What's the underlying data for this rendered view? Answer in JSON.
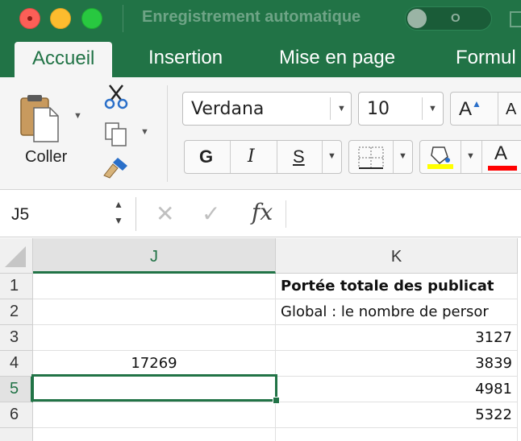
{
  "titlebar": {
    "autosave_label": "Enregistrement automatique",
    "toggle_state": "O"
  },
  "tabs": [
    {
      "label": "Accueil",
      "active": true
    },
    {
      "label": "Insertion",
      "active": false
    },
    {
      "label": "Mise en page",
      "active": false
    },
    {
      "label": "Formul",
      "active": false
    }
  ],
  "ribbon": {
    "paste_label": "Coller",
    "font_name": "Verdana",
    "font_size": "10",
    "grow_font_label": "A",
    "shrink_font_label": "A",
    "bold_label": "G",
    "italic_label": "I",
    "underline_label": "S",
    "font_color_label": "A",
    "fill_color": "#ffff00",
    "font_color": "#ff0000"
  },
  "formula_bar": {
    "name_box": "J5",
    "cancel_symbol": "✕",
    "enter_symbol": "✓",
    "fx_label": "fx",
    "formula_value": ""
  },
  "grid": {
    "columns": [
      {
        "label": "J",
        "selected": true
      },
      {
        "label": "K",
        "selected": false
      }
    ],
    "rows": [
      {
        "label": "1",
        "selected": false,
        "cells": [
          "",
          "Portée totale des publicat"
        ]
      },
      {
        "label": "2",
        "selected": false,
        "cells": [
          "",
          "Global : le nombre de persor"
        ]
      },
      {
        "label": "3",
        "selected": false,
        "cells": [
          "",
          "3127"
        ]
      },
      {
        "label": "4",
        "selected": false,
        "cells": [
          "17269",
          "3839"
        ]
      },
      {
        "label": "5",
        "selected": true,
        "cells": [
          "",
          "4981"
        ]
      },
      {
        "label": "6",
        "selected": false,
        "cells": [
          "",
          "5322"
        ]
      }
    ],
    "selected_cell": "J5"
  },
  "colors": {
    "accent": "#217346"
  }
}
